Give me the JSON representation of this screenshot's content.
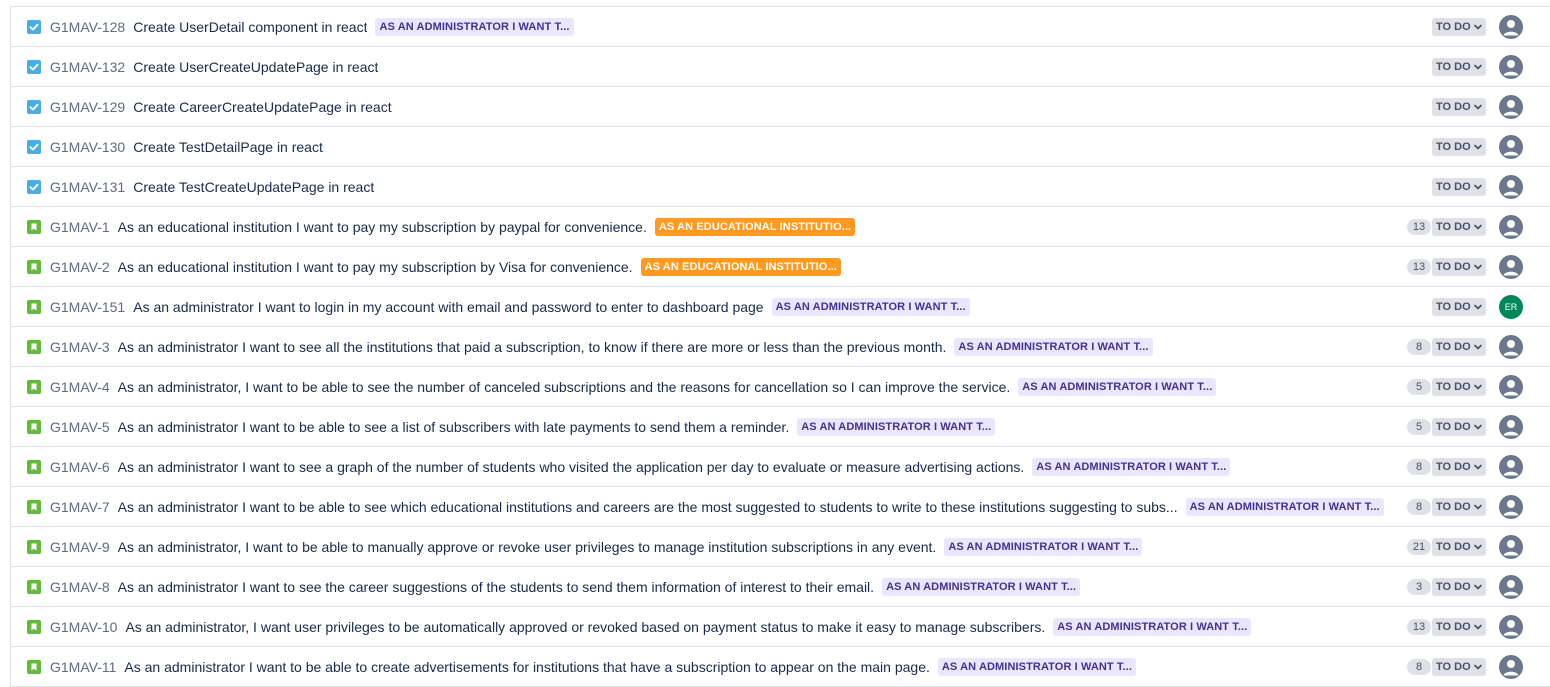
{
  "issues": [
    {
      "type": "task",
      "key": "G1MAV-128",
      "summary": "Create UserDetail component in react",
      "epic": "AS AN ADMINISTRATOR I WANT T...",
      "epic_color": "admin",
      "points": "",
      "status": "TO DO",
      "assignee": ""
    },
    {
      "type": "task",
      "key": "G1MAV-132",
      "summary": "Create UserCreateUpdatePage in react",
      "epic": "",
      "epic_color": "",
      "points": "",
      "status": "TO DO",
      "assignee": ""
    },
    {
      "type": "task",
      "key": "G1MAV-129",
      "summary": "Create CareerCreateUpdatePage in react",
      "epic": "",
      "epic_color": "",
      "points": "",
      "status": "TO DO",
      "assignee": ""
    },
    {
      "type": "task",
      "key": "G1MAV-130",
      "summary": "Create TestDetailPage in react",
      "epic": "",
      "epic_color": "",
      "points": "",
      "status": "TO DO",
      "assignee": ""
    },
    {
      "type": "task",
      "key": "G1MAV-131",
      "summary": "Create TestCreateUpdatePage in react",
      "epic": "",
      "epic_color": "",
      "points": "",
      "status": "TO DO",
      "assignee": ""
    },
    {
      "type": "story",
      "key": "G1MAV-1",
      "summary": "As an educational institution I want to pay my subscription by paypal for convenience.",
      "epic": "AS AN EDUCATIONAL INSTITUTIO...",
      "epic_color": "edu",
      "points": "13",
      "status": "TO DO",
      "assignee": ""
    },
    {
      "type": "story",
      "key": "G1MAV-2",
      "summary": "As an educational institution I want to pay my subscription by Visa for convenience.",
      "epic": "AS AN EDUCATIONAL INSTITUTIO...",
      "epic_color": "edu",
      "points": "13",
      "status": "TO DO",
      "assignee": ""
    },
    {
      "type": "story",
      "key": "G1MAV-151",
      "summary": "As an administrator I want to login in my account with email and password to enter to dashboard page",
      "epic": "AS AN ADMINISTRATOR I WANT T...",
      "epic_color": "admin",
      "points": "",
      "status": "TO DO",
      "assignee": "ER"
    },
    {
      "type": "story",
      "key": "G1MAV-3",
      "summary": "As an administrator I want to see all the institutions that paid a subscription, to know if there are more or less than the previous month.",
      "epic": "AS AN ADMINISTRATOR I WANT T...",
      "epic_color": "admin",
      "points": "8",
      "status": "TO DO",
      "assignee": ""
    },
    {
      "type": "story",
      "key": "G1MAV-4",
      "summary": "As an administrator, I want to be able to see the number of canceled subscriptions and the reasons for cancellation so I can improve the service.",
      "epic": "AS AN ADMINISTRATOR I WANT T...",
      "epic_color": "admin",
      "points": "5",
      "status": "TO DO",
      "assignee": ""
    },
    {
      "type": "story",
      "key": "G1MAV-5",
      "summary": "As an administrator I want to be able to see a list of subscribers with late payments to send them a reminder.",
      "epic": "AS AN ADMINISTRATOR I WANT T...",
      "epic_color": "admin",
      "points": "5",
      "status": "TO DO",
      "assignee": ""
    },
    {
      "type": "story",
      "key": "G1MAV-6",
      "summary": "As an administrator I want to see a graph of the number of students who visited the application per day to evaluate or measure advertising actions.",
      "epic": "AS AN ADMINISTRATOR I WANT T...",
      "epic_color": "admin",
      "points": "8",
      "status": "TO DO",
      "assignee": ""
    },
    {
      "type": "story",
      "key": "G1MAV-7",
      "summary": "As an administrator I want to be able to see which educational institutions and careers are the most suggested to students to write to these institutions suggesting to subs...",
      "epic": "AS AN ADMINISTRATOR I WANT T...",
      "epic_color": "admin",
      "points": "8",
      "status": "TO DO",
      "assignee": ""
    },
    {
      "type": "story",
      "key": "G1MAV-9",
      "summary": "As an administrator, I want to be able to manually approve or revoke user privileges to manage institution subscriptions in any event.",
      "epic": "AS AN ADMINISTRATOR I WANT T...",
      "epic_color": "admin",
      "points": "21",
      "status": "TO DO",
      "assignee": ""
    },
    {
      "type": "story",
      "key": "G1MAV-8",
      "summary": "As an administrator I want to see the career suggestions of the students to send them information of interest to their email.",
      "epic": "AS AN ADMINISTRATOR I WANT T...",
      "epic_color": "admin",
      "points": "3",
      "status": "TO DO",
      "assignee": ""
    },
    {
      "type": "story",
      "key": "G1MAV-10",
      "summary": "As an administrator, I want user privileges to be automatically approved or revoked based on payment status to make it easy to manage subscribers.",
      "epic": "AS AN ADMINISTRATOR I WANT T...",
      "epic_color": "admin",
      "points": "13",
      "status": "TO DO",
      "assignee": ""
    },
    {
      "type": "story",
      "key": "G1MAV-11",
      "summary": "As an administrator I want to be able to create advertisements for institutions that have a subscription to appear on the main page.",
      "epic": "AS AN ADMINISTRATOR I WANT T...",
      "epic_color": "admin",
      "points": "8",
      "status": "TO DO",
      "assignee": ""
    }
  ],
  "colors": {
    "task": "#4bade8",
    "story": "#63ba3c",
    "epic_admin_bg": "#eae6ff",
    "epic_admin_fg": "#403294",
    "epic_edu_bg": "#ff991f",
    "avatar_default": "#6b778c",
    "avatar_er": "#00875a"
  }
}
